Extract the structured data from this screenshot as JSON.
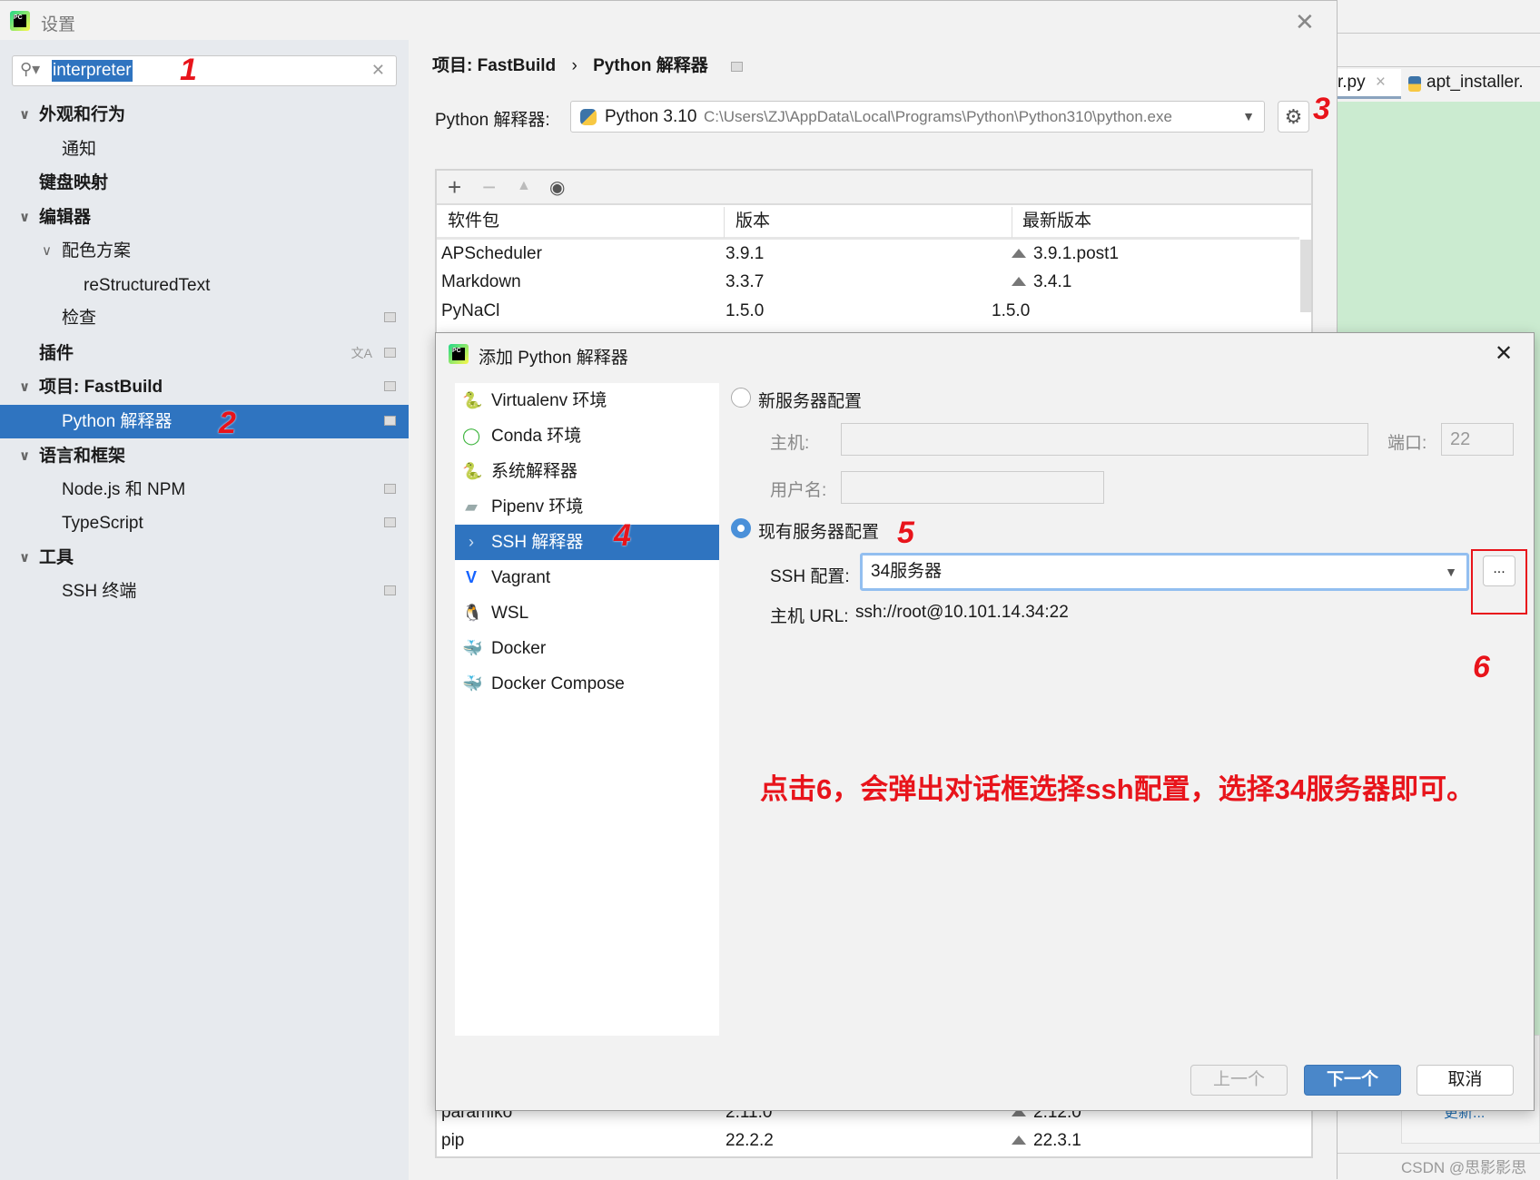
{
  "settings": {
    "title": "设置",
    "search": {
      "value": "interpreter"
    },
    "tree": [
      {
        "label": "外观和行为",
        "bold": true,
        "chevron": true
      },
      {
        "label": "通知"
      },
      {
        "label": "键盘映射",
        "bold": true
      },
      {
        "label": "编辑器",
        "bold": true,
        "chevron": true
      },
      {
        "label": "配色方案",
        "chevron": true
      },
      {
        "label": "reStructuredText"
      },
      {
        "label": "检查"
      },
      {
        "label": "插件",
        "bold": true
      },
      {
        "label": "项目: FastBuild",
        "bold": true,
        "chevron": true
      },
      {
        "label": "Python 解释器",
        "selected": true
      },
      {
        "label": "语言和框架",
        "bold": true,
        "chevron": true
      },
      {
        "label": "Node.js 和 NPM"
      },
      {
        "label": "TypeScript"
      },
      {
        "label": "工具",
        "bold": true,
        "chevron": true
      },
      {
        "label": "SSH 终端"
      }
    ],
    "breadcrumb": {
      "project": "项目: FastBuild",
      "separator": "›",
      "page": "Python 解释器"
    },
    "interpreter": {
      "label": "Python 解释器:",
      "name": "Python 3.10",
      "path": "C:\\Users\\ZJ\\AppData\\Local\\Programs\\Python\\Python310\\python.exe"
    },
    "packages": {
      "headers": [
        "软件包",
        "版本",
        "最新版本"
      ],
      "rows_top": [
        {
          "name": "APScheduler",
          "version": "3.9.1",
          "latest": "3.9.1.post1",
          "upgrade": true
        },
        {
          "name": "Markdown",
          "version": "3.3.7",
          "latest": "3.4.1",
          "upgrade": true
        },
        {
          "name": "PyNaCl",
          "version": "1.5.0",
          "latest": "1.5.0",
          "upgrade": false
        }
      ],
      "rows_bottom": [
        {
          "name": "paramiko",
          "version": "2.11.0",
          "latest": "2.12.0",
          "upgrade": true
        },
        {
          "name": "pip",
          "version": "22.2.2",
          "latest": "22.3.1",
          "upgrade": true
        }
      ]
    }
  },
  "editor": {
    "tabs": [
      {
        "label": "r.py"
      },
      {
        "label": "apt_installer."
      }
    ],
    "update_link": "更新...",
    "watermark": "CSDN @思影影思"
  },
  "dialog": {
    "title": "添加 Python 解释器",
    "types": [
      {
        "label": "Virtualenv 环境",
        "icon": "virtualenv-icon"
      },
      {
        "label": "Conda 环境",
        "icon": "conda-icon"
      },
      {
        "label": "系统解释器",
        "icon": "python-icon"
      },
      {
        "label": "Pipenv 环境",
        "icon": "pipenv-icon"
      },
      {
        "label": "SSH 解释器",
        "icon": "ssh-icon",
        "selected": true
      },
      {
        "label": "Vagrant",
        "icon": "vagrant-icon"
      },
      {
        "label": "WSL",
        "icon": "linux-penguin-icon"
      },
      {
        "label": "Docker",
        "icon": "docker-icon"
      },
      {
        "label": "Docker Compose",
        "icon": "docker-compose-icon"
      }
    ],
    "new_server": {
      "label": "新服务器配置",
      "host_label": "主机:",
      "host_value": "",
      "port_label": "端口:",
      "port_value": "22",
      "user_label": "用户名:",
      "user_value": ""
    },
    "existing_server": {
      "label": "现有服务器配置",
      "selected": true,
      "ssh_config_label": "SSH 配置:",
      "ssh_config_value": "34服务器",
      "browse_label": "...",
      "host_url_label": "主机 URL:",
      "host_url_value": "ssh://root@10.101.14.34:22"
    },
    "buttons": {
      "prev": "上一个",
      "next": "下一个",
      "cancel": "取消"
    }
  },
  "annotations": {
    "n1": "1",
    "n2": "2",
    "n3": "3",
    "n4": "4",
    "n5": "5",
    "n6": "6",
    "note": "点击6，会弹出对话框选择ssh配置，选择34服务器即可。",
    "color": "#e8141b"
  }
}
